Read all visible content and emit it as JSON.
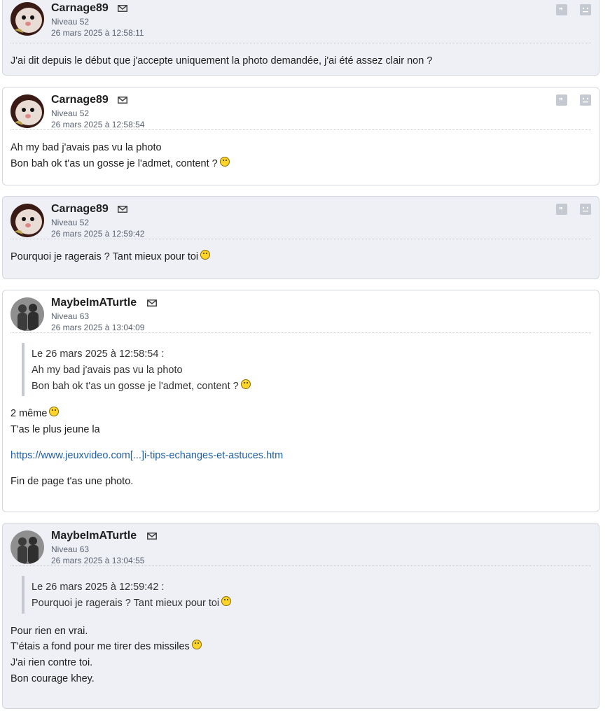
{
  "posts": [
    {
      "author": "Carnage89",
      "level": "Niveau 52",
      "date": "26 mars 2025 à 12:58:11",
      "lines": [
        "J'ai dit depuis le début que j'accepte uniquement la photo demandée, j'ai été assez clair non ?"
      ]
    },
    {
      "author": "Carnage89",
      "level": "Niveau 52",
      "date": "26 mars 2025 à 12:58:54",
      "lines": [
        "Ah my bad j'avais pas vu la photo",
        "Bon bah ok t'as un gosse je l'admet, content ?"
      ]
    },
    {
      "author": "Carnage89",
      "level": "Niveau 52",
      "date": "26 mars 2025 à 12:59:42",
      "lines": [
        "Pourquoi je ragerais ? Tant mieux pour toi"
      ]
    },
    {
      "author": "MaybeImATurtle",
      "level": "Niveau 63",
      "date": "26 mars 2025 à 13:04:09",
      "quote": [
        "Le 26 mars 2025 à 12:58:54 :",
        "Ah my bad j'avais pas vu la photo",
        "Bon bah ok t'as un gosse je l'admet, content ?"
      ],
      "lines": [
        "2 même",
        "T'as le plus jeune la"
      ],
      "link": "https://www.jeuxvideo.com[...]i-tips-echanges-et-astuces.htm",
      "after": "Fin de page t'as une photo."
    },
    {
      "author": "MaybeImATurtle",
      "level": "Niveau 63",
      "date": "26 mars 2025 à 13:04:55",
      "quote": [
        "Le 26 mars 2025 à 12:59:42 :",
        "Pourquoi je ragerais ? Tant mieux pour toi"
      ],
      "lines": [
        "Pour rien en vrai.",
        "T'étais a fond pour me tirer des missiles",
        "J'ai rien contre toi.",
        "Bon courage khey."
      ]
    }
  ],
  "icons": {
    "mail": "envelope-icon",
    "quote": "quote-icon",
    "report": "report-icon",
    "smiley": "smiley-icon"
  }
}
